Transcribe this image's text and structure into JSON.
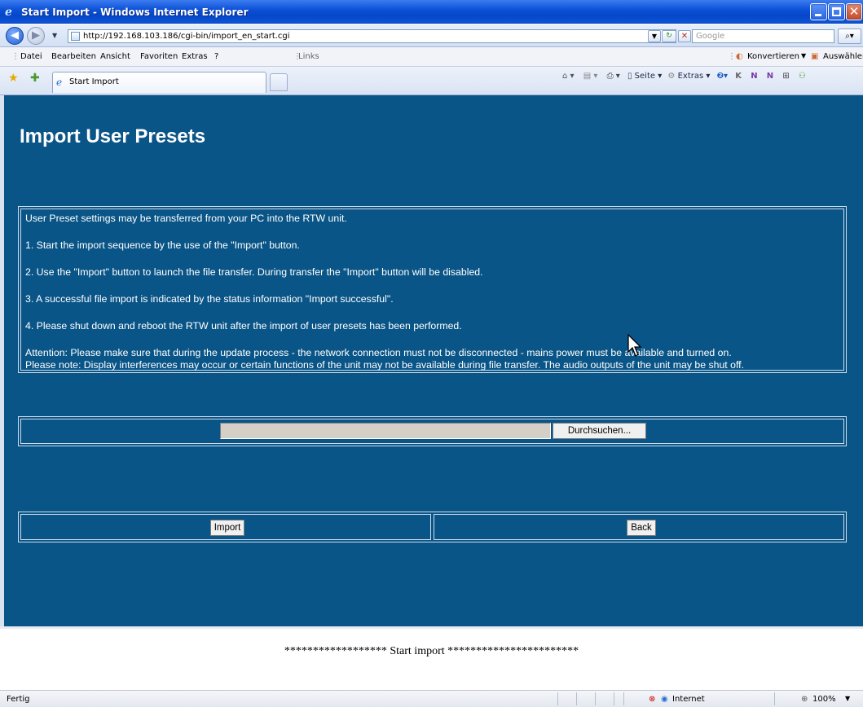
{
  "window": {
    "title": "Start Import - Windows Internet Explorer"
  },
  "address_bar": {
    "url": "http://192.168.103.186/cgi-bin/import_en_start.cgi",
    "search_placeholder": "Google"
  },
  "menu": {
    "items": [
      "Datei",
      "Bearbeiten",
      "Ansicht",
      "Favoriten",
      "Extras",
      "?"
    ],
    "links_label": "Links",
    "right_items": [
      "Konvertieren",
      "Auswählen"
    ]
  },
  "tabs": [
    {
      "label": "Start Import"
    }
  ],
  "command_bar": {
    "page_label": "Seite",
    "tools_label": "Extras"
  },
  "page": {
    "title": "Import User Presets",
    "info_lines": [
      "User Preset settings may be transferred from your PC into the RTW unit.",
      "1. Start the import sequence by the use of the \"Import\" button.",
      "2. Use the \"Import\" button to launch the file transfer. During transfer the \"Import\" button will be disabled.",
      "3. A successful file import is indicated by the status information \"Import successful\".",
      "4. Please shut down and reboot the RTW unit after the import of user presets has been performed.",
      "Attention: Please make sure that during the update process - the network connection must not be disconnected - mains power must be available and turned on.",
      "Please note: Display interferences may occur or certain functions of the unit may not be available during file transfer. The audio outputs of the unit may be shut off."
    ],
    "file_field_value": "",
    "browse_label": "Durchsuchen...",
    "import_label": "Import",
    "back_label": "Back",
    "footer_message": "****************** Start import ***********************"
  },
  "status_bar": {
    "left_text": "Fertig",
    "zone": "Internet",
    "zoom": "100%"
  }
}
